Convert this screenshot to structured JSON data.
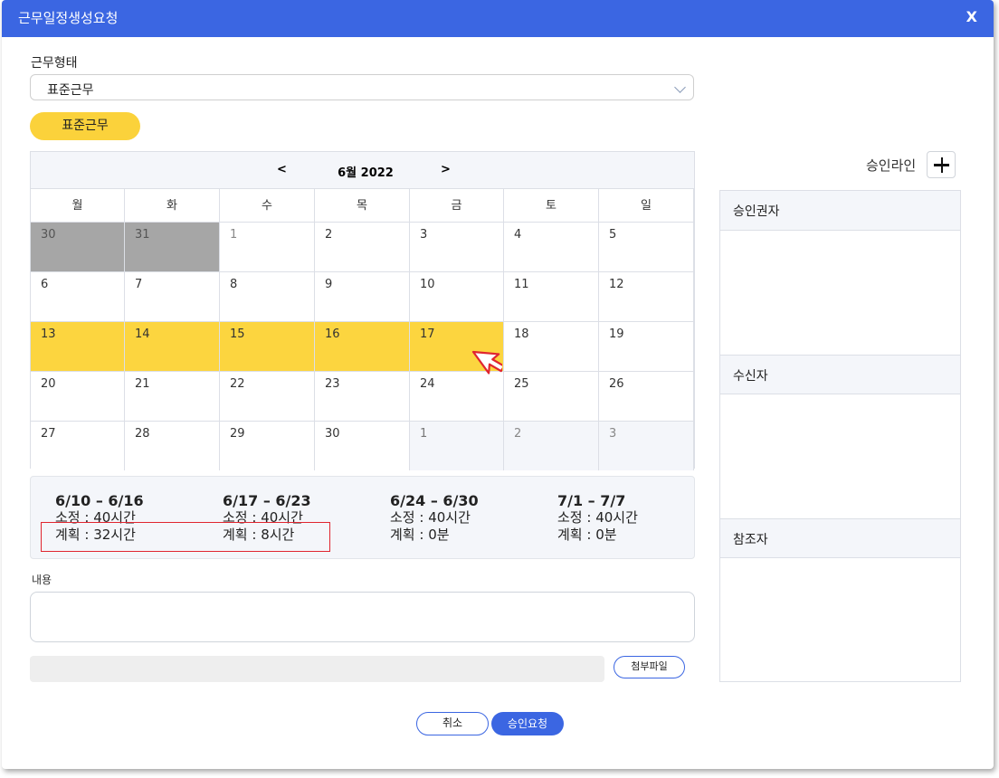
{
  "dialog": {
    "title": "근무일정생성요청",
    "close_label": "X"
  },
  "form": {
    "work_type_label": "근무형태",
    "work_type_value": "표준근무",
    "work_type_pill": "표준근무",
    "content_label": "내용",
    "content_value": "",
    "attach_label": "첨부파일"
  },
  "calendar": {
    "prev_label": "<",
    "next_label": ">",
    "month_title": "6월 2022",
    "weekdays": [
      "월",
      "화",
      "수",
      "목",
      "금",
      "토",
      "일"
    ],
    "weeks": [
      [
        "30",
        "31",
        "1",
        "2",
        "3",
        "4",
        "5"
      ],
      [
        "6",
        "7",
        "8",
        "9",
        "10",
        "11",
        "12"
      ],
      [
        "13",
        "14",
        "15",
        "16",
        "17",
        "18",
        "19"
      ],
      [
        "20",
        "21",
        "22",
        "23",
        "24",
        "25",
        "26"
      ],
      [
        "27",
        "28",
        "29",
        "30",
        "1",
        "2",
        "3"
      ]
    ],
    "highlight_color": "#fcd53f"
  },
  "summary": [
    {
      "range": "6/10 – 6/16",
      "required": "소정 : 40시간",
      "planned": "계획 : 32시간"
    },
    {
      "range": "6/17 – 6/23",
      "required": "소정 : 40시간",
      "planned": "계획 : 8시간"
    },
    {
      "range": "6/24 – 6/30",
      "required": "소정 : 40시간",
      "planned": "계획 : 0분"
    },
    {
      "range": "7/1 – 7/7",
      "required": "소정 : 40시간",
      "planned": "계획 : 0분"
    }
  ],
  "approval": {
    "line_label": "승인라인",
    "add_icon": "plus-icon",
    "sections": [
      "승인권자",
      "수신자",
      "참조자"
    ]
  },
  "buttons": {
    "cancel": "취소",
    "submit": "승인요청"
  },
  "colors": {
    "accent": "#3b66e2",
    "highlight": "#fcd53f",
    "annotation": "#e0252f"
  }
}
